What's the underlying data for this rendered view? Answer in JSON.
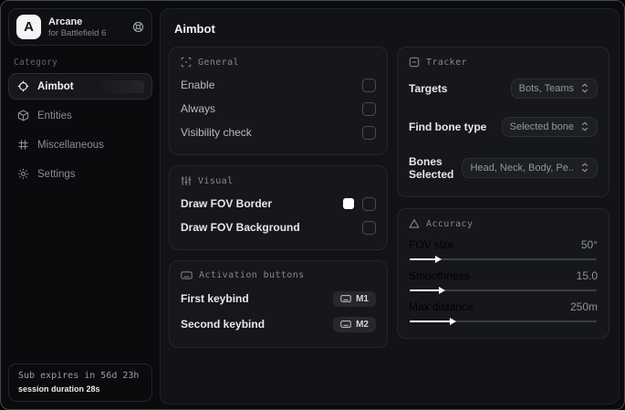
{
  "app": {
    "logo_letter": "A",
    "name": "Arcane",
    "subtitle": "for Battlefield 6"
  },
  "sidebar": {
    "category_label": "Category",
    "items": [
      {
        "label": "Aimbot",
        "icon": "crosshair-icon",
        "active": true
      },
      {
        "label": "Entities",
        "icon": "cube-icon",
        "active": false
      },
      {
        "label": "Miscellaneous",
        "icon": "grid-icon",
        "active": false
      },
      {
        "label": "Settings",
        "icon": "gear-icon",
        "active": false
      }
    ],
    "subscription": {
      "line1": "Sub expires in 56d 23h",
      "line2": "session duration 28s"
    }
  },
  "main": {
    "title": "Aimbot",
    "cards": {
      "general": {
        "title": "General",
        "rows": [
          {
            "label": "Enable",
            "checked": false
          },
          {
            "label": "Always",
            "checked": false
          },
          {
            "label": "Visibility check",
            "checked": false
          }
        ]
      },
      "visual": {
        "title": "Visual",
        "rows": [
          {
            "label": "Draw FOV Border",
            "color": "#ffffff",
            "checked": false
          },
          {
            "label": "Draw FOV Background",
            "checked": false
          }
        ]
      },
      "activation": {
        "title": "Activation buttons",
        "rows": [
          {
            "label": "First keybind",
            "key": "M1"
          },
          {
            "label": "Second keybind",
            "key": "M2"
          }
        ]
      },
      "tracker": {
        "title": "Tracker",
        "rows": [
          {
            "label": "Targets",
            "value": "Bots, Teams"
          },
          {
            "label": "Find bone type",
            "value": "Selected bone"
          },
          {
            "label": "Bones Selected",
            "value": "Head, Neck, Body, Pe.."
          }
        ]
      },
      "accuracy": {
        "title": "Accuracy",
        "sliders": [
          {
            "label": "FOV size",
            "value": "50°",
            "fill_percent": 14
          },
          {
            "label": "Smoothness",
            "value": "15.0",
            "fill_percent": 16
          },
          {
            "label": "Max distance",
            "value": "250m",
            "fill_percent": 22
          }
        ]
      }
    }
  },
  "colors": {
    "fov_border_swatch": "#ffffff",
    "slider_fill": "#ffffff",
    "panel_background": "#121318",
    "card_background": "#16171c"
  }
}
